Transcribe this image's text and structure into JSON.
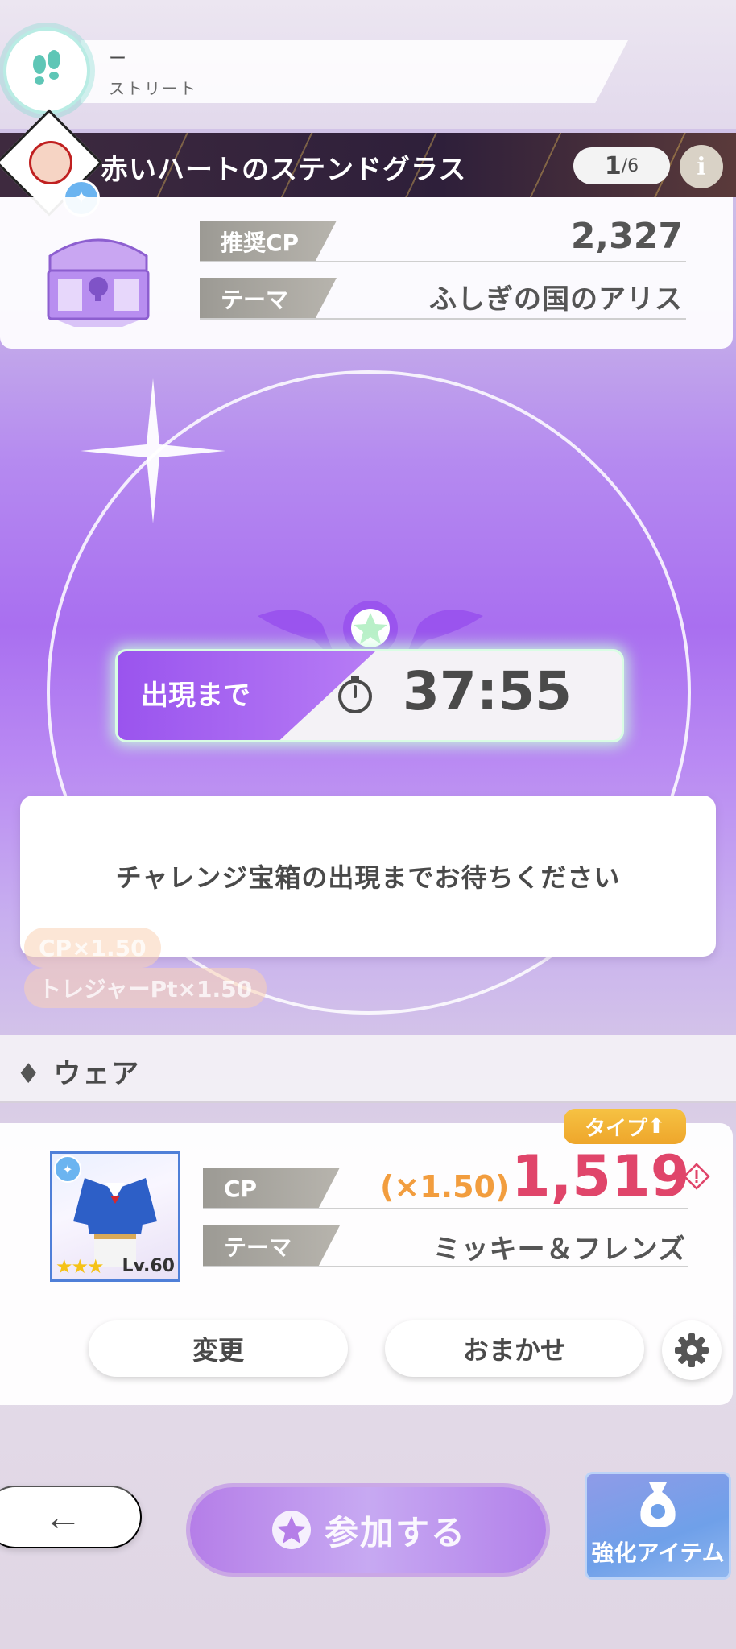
{
  "header": {
    "location_dash": "ー",
    "location_label": "ストリート"
  },
  "treasure": {
    "title": "赤いハートのステンドグラス",
    "count_current": "1",
    "count_total": "/6",
    "info_icon": "i",
    "recommended_cp_label": "推奨CP",
    "recommended_cp_value": "2,327",
    "theme_label": "テーマ",
    "theme_value": "ふしぎの国のアリス"
  },
  "timer": {
    "label": "出現まで",
    "value": "37:55"
  },
  "message": "チャレンジ宝箱の出現までお待ちください",
  "boosts": {
    "cp": "CP×1.50",
    "treasure_pt": "トレジャーPt×1.50"
  },
  "wear": {
    "section_title": "ウェア",
    "type_badge": "タイプ",
    "level": "Lv.60",
    "cp_label": "CP",
    "multiplier": "(×1.50)",
    "cp_value": "1,519",
    "theme_label": "テーマ",
    "theme_value": "ミッキー＆フレンズ",
    "change_button": "変更",
    "auto_button": "おまかせ"
  },
  "bottom": {
    "back_arrow": "←",
    "join_button": "参加する",
    "enhance_button": "強化アイテム"
  },
  "colors": {
    "accent_purple": "#a96ff0",
    "cp_red": "#e0456a",
    "multiplier_orange": "#f29d3e",
    "type_badge_gold": "#f0b136"
  }
}
